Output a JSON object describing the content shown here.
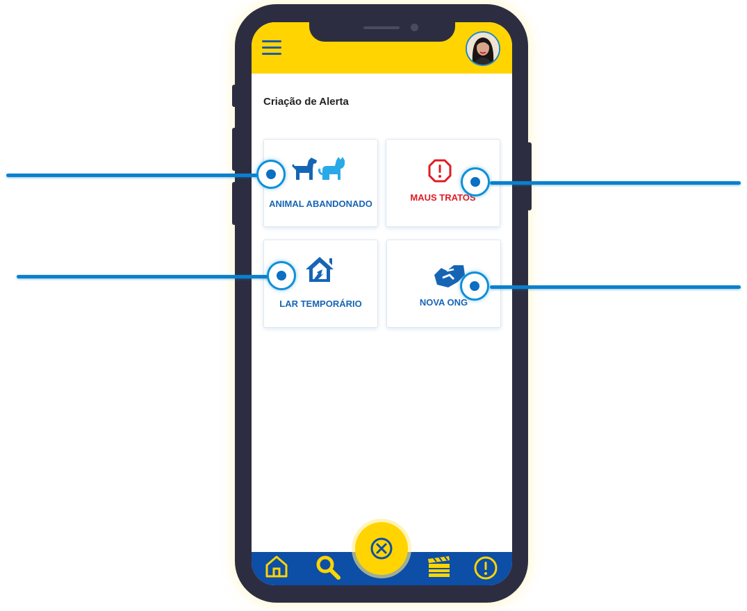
{
  "header": {
    "menu_icon": "hamburger-menu-icon",
    "avatar": "user-avatar"
  },
  "page": {
    "title": "Criação de Alerta"
  },
  "cards": [
    {
      "label": "ANIMAL ABANDONADO",
      "icon": "dog-cat-icon",
      "color": "#1665b5"
    },
    {
      "label": "MAUS TRATOS",
      "icon": "warning-octagon-icon",
      "color": "#e01b22"
    },
    {
      "label": "LAR TEMPORÁRIO",
      "icon": "house-icon",
      "color": "#1665b5"
    },
    {
      "label": "NOVA ONG",
      "icon": "handshake-icon",
      "color": "#1665b5"
    }
  ],
  "bottom_nav": {
    "items": [
      "home-icon",
      "search-icon",
      "close-circle-icon",
      "clapperboard-icon",
      "alert-circle-icon"
    ]
  },
  "colors": {
    "primary_yellow": "#ffd400",
    "primary_blue": "#0d4ea6",
    "accent_blue": "#1665b5",
    "alert_red": "#e01b22",
    "hotspot_blue": "#0e8fd8"
  }
}
